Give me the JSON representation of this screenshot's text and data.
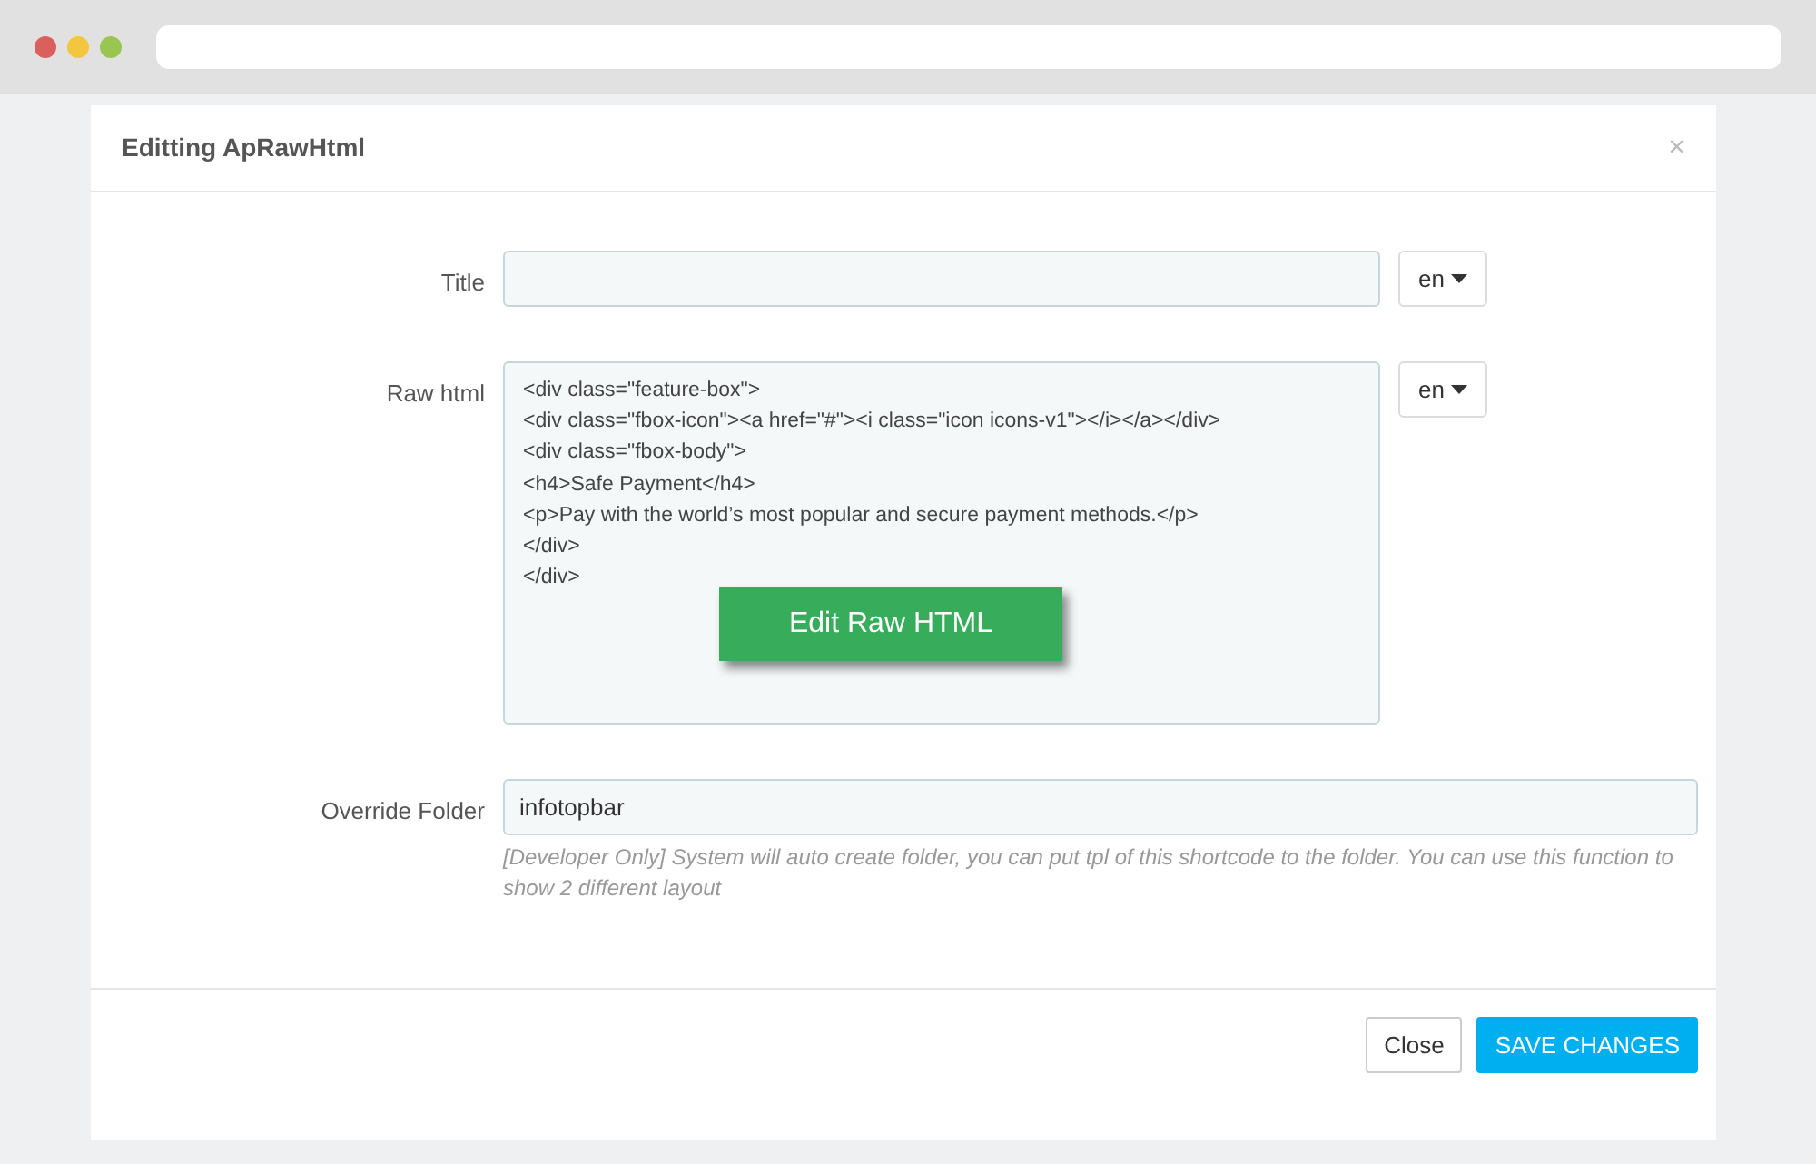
{
  "modal": {
    "title": "Editting ApRawHtml",
    "close": "×"
  },
  "fields": [
    {
      "kind": "input",
      "label": "Title",
      "lang": "en"
    },
    {
      "kind": "code",
      "label": "Raw html",
      "lang": "en",
      "lines": [
        "<div class=\"feature-box\">",
        "<div class=\"fbox-icon\"><a href=\"#\"><i class=\"icon icons-v1\"></i></a></div>",
        "<div class=\"fbox-body\">",
        "<h4>Safe Payment</h4>",
        "<p>Pay with the world’s most popular and secure payment methods.</p>",
        "</div>",
        "</div>"
      ],
      "action": "Edit Raw HTML"
    },
    {
      "kind": "wide",
      "label": "Override Folder",
      "value": "infotopbar",
      "help": "[Developer Only] System will auto create folder, you can put tpl of this shortcode to the folder. You can use this function to show 2 different layout"
    }
  ],
  "buttons": [
    {
      "label": "Close",
      "kind": "default"
    },
    {
      "label": "SAVE CHANGES",
      "kind": "primary"
    }
  ]
}
